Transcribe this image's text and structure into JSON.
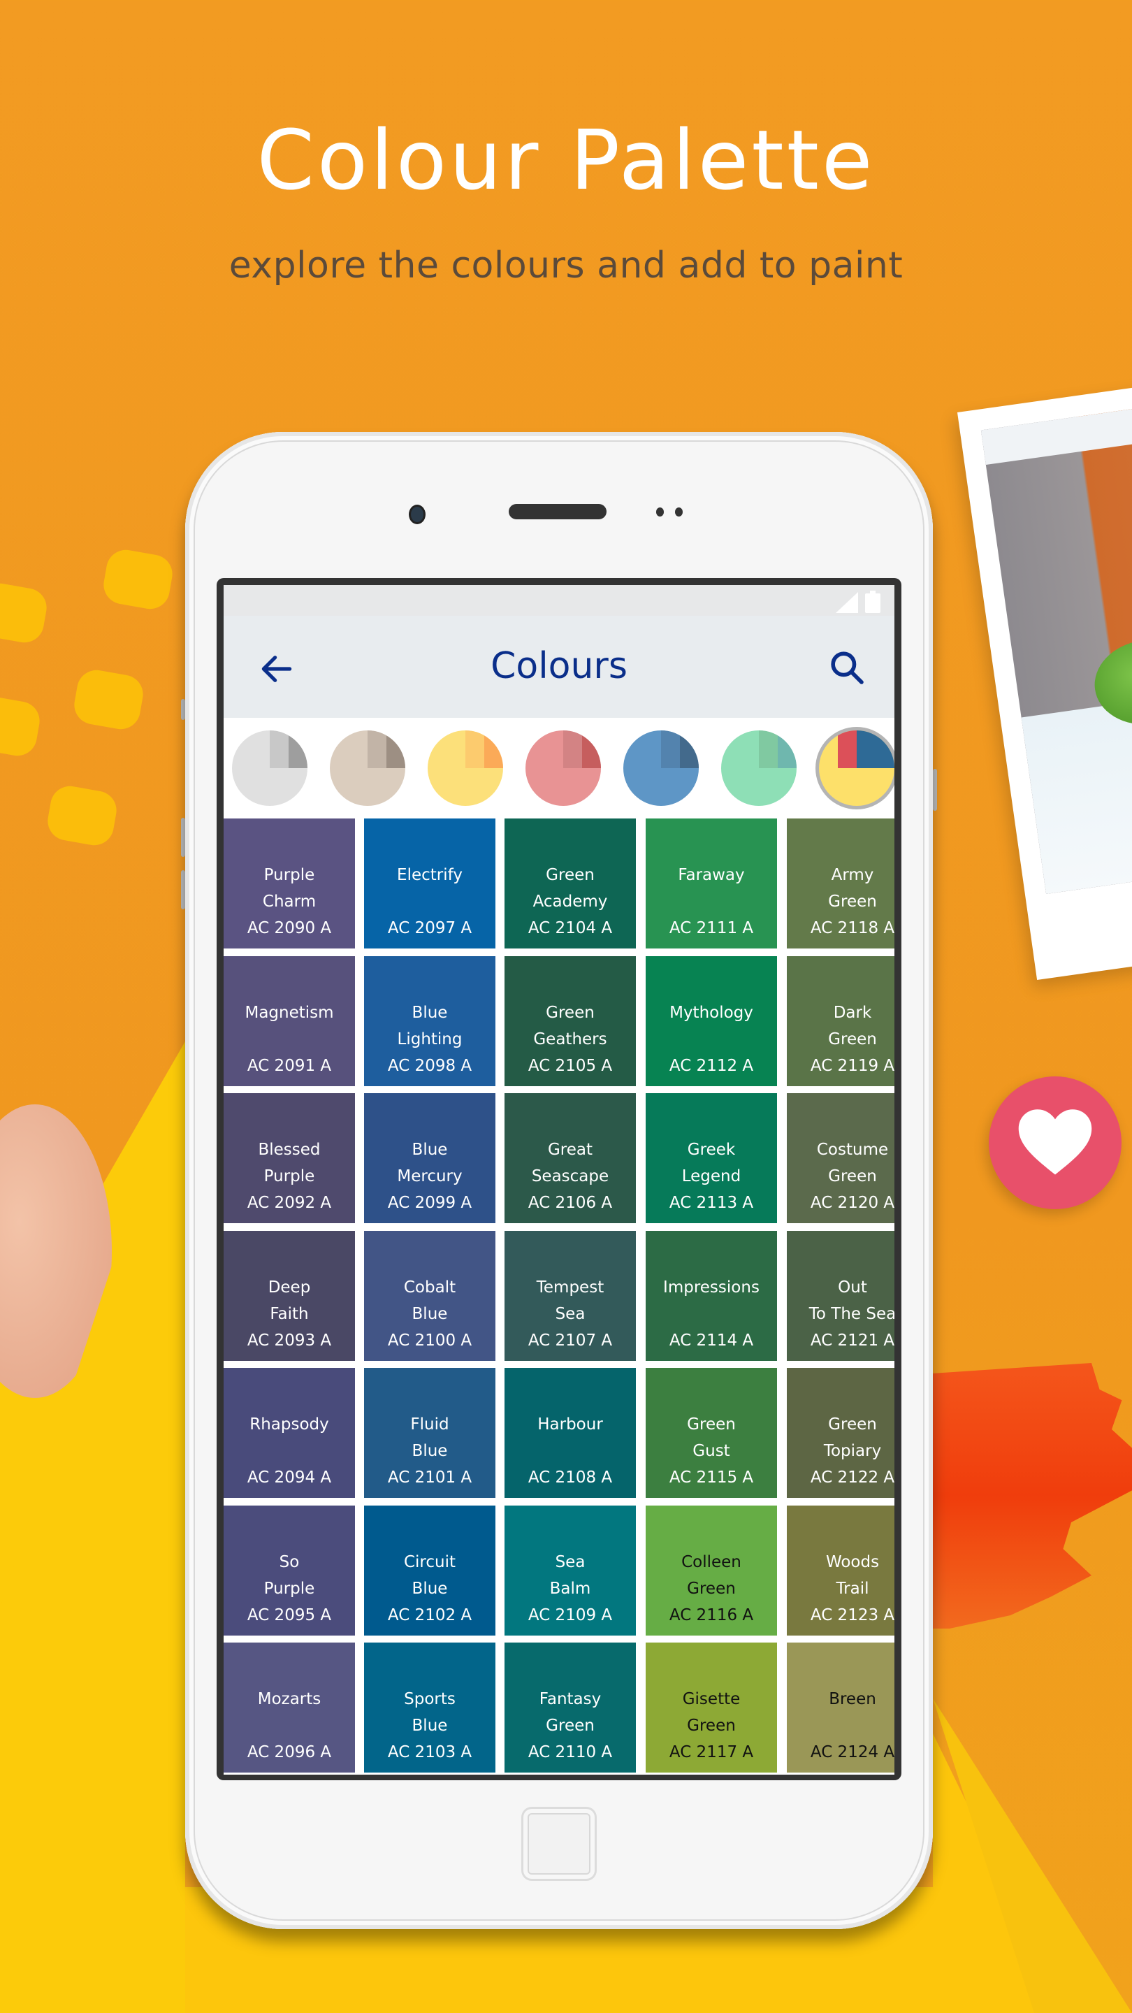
{
  "hero": {
    "title": "Colour Palette",
    "subtitle": "explore the colours and add to paint"
  },
  "app": {
    "title": "Colours",
    "back_icon": "arrow-left-icon",
    "search_icon": "search-icon",
    "accent_color": "#0A2E8A"
  },
  "families": [
    {
      "name": "grey",
      "base": "#E0E0E0",
      "q1": "#C8C8C8",
      "q2": "#9E9E9E",
      "selected": false
    },
    {
      "name": "beige",
      "base": "#DBCDBE",
      "q1": "#C2B4A7",
      "q2": "#9D8F83",
      "selected": false
    },
    {
      "name": "yellow",
      "base": "#FCE07A",
      "q1": "#FCCB6E",
      "q2": "#FBAA58",
      "selected": false
    },
    {
      "name": "red",
      "base": "#E89394",
      "q1": "#D38384",
      "q2": "#C65E5E",
      "selected": false
    },
    {
      "name": "blue",
      "base": "#5E96C6",
      "q1": "#5383AE",
      "q2": "#436A8C",
      "selected": false
    },
    {
      "name": "green",
      "base": "#8EDFB6",
      "q1": "#80C9A1",
      "q2": "#6FB7AE",
      "selected": false
    },
    {
      "name": "multi",
      "base": "#FDE06A",
      "q1": "#DC5059",
      "q2": "#2E6A96",
      "selected": true
    }
  ],
  "swatches": [
    [
      {
        "name": "Purple\nCharm",
        "code": "AC 2090 A",
        "color": "#5A5382"
      },
      {
        "name": "Electrify",
        "code": "AC 2097 A",
        "color": "#0664A7"
      },
      {
        "name": "Green\nAcademy",
        "code": "AC 2104 A",
        "color": "#0E6654"
      },
      {
        "name": "Faraway",
        "code": "AC 2111 A",
        "color": "#289352"
      },
      {
        "name": "Army\nGreen",
        "code": "AC 2118 A",
        "color": "#637A4A"
      }
    ],
    [
      {
        "name": "Magnetism",
        "code": "AC 2091 A",
        "color": "#57517C"
      },
      {
        "name": "Blue\nLighting",
        "code": "AC 2098 A",
        "color": "#1E5E9E"
      },
      {
        "name": "Green\nGeathers",
        "code": "AC 2105 A",
        "color": "#245B46"
      },
      {
        "name": "Mythology",
        "code": "AC 2112 A",
        "color": "#078352"
      },
      {
        "name": "Dark\nGreen",
        "code": "AC 2119 A",
        "color": "#5A7448"
      }
    ],
    [
      {
        "name": "Blessed\nPurple",
        "code": "AC 2092 A",
        "color": "#4F4A6D"
      },
      {
        "name": "Blue\nMercury",
        "code": "AC 2099 A",
        "color": "#2E5189"
      },
      {
        "name": "Great\nSeascape",
        "code": "AC 2106 A",
        "color": "#2C594A"
      },
      {
        "name": "Greek\nLegend",
        "code": "AC 2113 A",
        "color": "#067A59"
      },
      {
        "name": "Costume\nGreen",
        "code": "AC 2120 A",
        "color": "#5B6A4C"
      }
    ],
    [
      {
        "name": "Deep\nFaith",
        "code": "AC 2093 A",
        "color": "#4A4865"
      },
      {
        "name": "Cobalt\nBlue",
        "code": "AC 2100 A",
        "color": "#425586"
      },
      {
        "name": "Tempest\nSea",
        "code": "AC 2107 A",
        "color": "#335A5A"
      },
      {
        "name": "Impressions",
        "code": "AC 2114 A",
        "color": "#2C6B45"
      },
      {
        "name": "Out\nTo The Sea",
        "code": "AC 2121 A",
        "color": "#4B6247"
      }
    ],
    [
      {
        "name": "Rhapsody",
        "code": "AC 2094 A",
        "color": "#494B7B"
      },
      {
        "name": "Fluid\nBlue",
        "code": "AC 2101 A",
        "color": "#225B89"
      },
      {
        "name": "Harbour",
        "code": "AC 2108 A",
        "color": "#05646B"
      },
      {
        "name": "Green\nGust",
        "code": "AC 2115 A",
        "color": "#3C7F40"
      },
      {
        "name": "Green\nTopiary",
        "code": "AC 2122 A",
        "color": "#5D6644"
      }
    ],
    [
      {
        "name": "So\nPurple",
        "code": "AC 2095 A",
        "color": "#4B4C7C"
      },
      {
        "name": "Circuit\nBlue",
        "code": "AC 2102 A",
        "color": "#005A8E"
      },
      {
        "name": "Sea\nBalm",
        "code": "AC 2109 A",
        "color": "#02777F"
      },
      {
        "name": "Colleen\nGreen",
        "code": "AC 2116 A",
        "color": "#66AD45",
        "dark_text": true
      },
      {
        "name": "Woods\nTrail",
        "code": "AC 2123 A",
        "color": "#79793F"
      }
    ],
    [
      {
        "name": "Mozarts",
        "code": "AC 2096 A",
        "color": "#565683"
      },
      {
        "name": "Sports\nBlue",
        "code": "AC 2103 A",
        "color": "#02658A"
      },
      {
        "name": "Fantasy\nGreen",
        "code": "AC 2110 A",
        "color": "#076A6C"
      },
      {
        "name": "Gisette\nGreen",
        "code": "AC 2117 A",
        "color": "#8DA935",
        "dark_text": true
      },
      {
        "name": "Breen",
        "code": "AC 2124 A",
        "color": "#9A9757",
        "dark_text": true
      }
    ]
  ],
  "decor": {
    "heart_icon": "heart-icon",
    "heart_color": "#E8506A"
  }
}
